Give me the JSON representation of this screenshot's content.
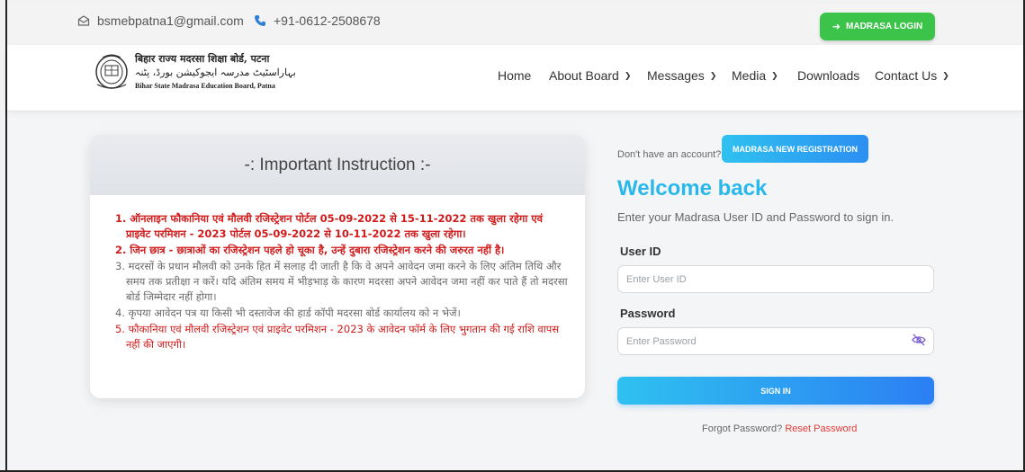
{
  "topbar": {
    "email": "bsmebpatna1@gmail.com",
    "phone": "+91-0612-2508678",
    "login_label": "MADRASA LOGIN"
  },
  "logo": {
    "name_hindi": "बिहार राज्य मदरसा शिक्षा बोर्ड, पटना",
    "name_urdu": "بہاراسٹیٹ مدرسہ ایجوکیشن بورڈ، پٹنہ",
    "name_english": "Bihar State Madrasa Education Board, Patna"
  },
  "nav": {
    "items": [
      {
        "label": "Home",
        "dropdown": false
      },
      {
        "label": "About Board",
        "dropdown": true
      },
      {
        "label": "Messages",
        "dropdown": true
      },
      {
        "label": "Media",
        "dropdown": true
      },
      {
        "label": "Downloads",
        "dropdown": false
      },
      {
        "label": "Contact Us",
        "dropdown": true
      }
    ]
  },
  "instructions": {
    "title": "-: Important Instruction :-",
    "items": [
      {
        "text": "1. ऑनलाइन फौकानिया एवं मौलवी रजिस्ट्रेशन पोर्टल 05-09-2022 से 15-11-2022 तक खुला रहेगा एवं प्राइवेट परमिशन - 2023 पोर्टल 05-09-2022 से 10-11-2022 तक खुला रहेगा।",
        "style": "red bold"
      },
      {
        "text": "2. जिन छात्र - छात्राओं का रजिस्ट्रेशन पहले हो चूका है, उन्हें दुबारा रजिस्ट्रेशन करने की जरुरत नहीं है।",
        "style": "red bold"
      },
      {
        "text": "3. मदरसों के प्रधान मौलवी को उनके हित में सलाह दी जाती है कि वे अपने आवेदन जमा करने के लिए अंतिम तिथि और समय तक प्रतीक्षा न करें। यदि अंतिम समय में भीड़भाड़ के कारण मदरसा अपने आवेदन जमा नहीं कर पाते हैं तो मदरसा बोर्ड जिम्मेदार नहीं होगा।",
        "style": "gray"
      },
      {
        "text": "4. कृपया आवेदन पत्र या किसी भी दस्तावेज की हार्ड कॉपी मदरसा बोर्ड कार्यालय को न भेजें।",
        "style": "gray"
      },
      {
        "text": "5. फौकानिया एवं मौलवी रजिस्ट्रेशन एवं प्राइवेट परमिशन - 2023 के आवेदन फॉर्म के लिए भुगतान की गई राशि वापस नहीं की जाएगी।",
        "style": "red"
      }
    ]
  },
  "login": {
    "no_account": "Don't have an account?",
    "register_label": "MADRASA NEW REGISTRATION",
    "welcome": "Welcome back",
    "subtitle": "Enter your Madrasa User ID and Password to sign in.",
    "userid_label": "User ID",
    "userid_placeholder": "Enter User ID",
    "userid_value": "",
    "password_label": "Password",
    "password_placeholder": "Enter Password",
    "password_value": "",
    "signin_label": "SIGN IN",
    "forgot_text": "Forgot Password?",
    "reset_text": "Reset Password"
  },
  "colors": {
    "accent_blue": "#2ab8ec",
    "login_green": "#3cc44a",
    "reset_red": "#e53935",
    "instruction_red": "#d11a1a"
  }
}
